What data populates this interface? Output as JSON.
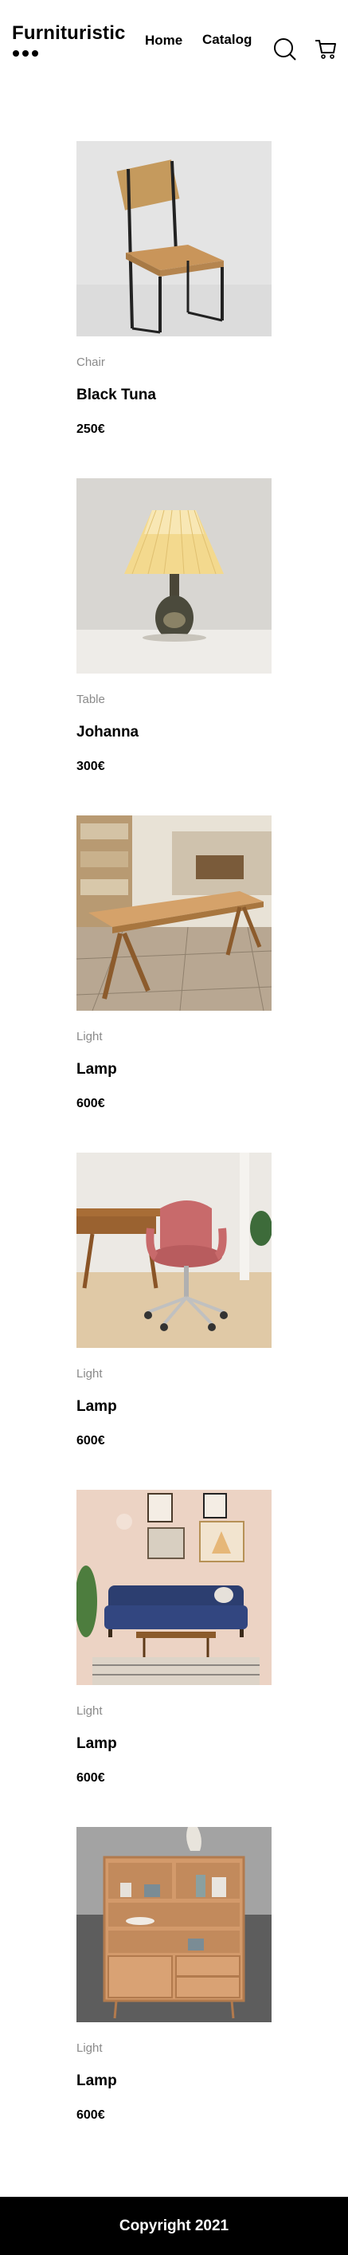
{
  "header": {
    "brand": "Furnituristic",
    "menu_icon": "dots-menu-icon",
    "nav": [
      {
        "label": "Home"
      },
      {
        "label": "Catalog"
      }
    ],
    "search_icon": "search-icon",
    "cart_icon": "cart-icon"
  },
  "products": [
    {
      "category": "Chair",
      "title": "Black Tuna",
      "price": "250€",
      "image": "wooden chair"
    },
    {
      "category": "Table",
      "title": "Johanna",
      "price": "300€",
      "image": "pleated table lamp"
    },
    {
      "category": "Light",
      "title": "Lamp",
      "price": "600€",
      "image": "wooden dining table"
    },
    {
      "category": "Light",
      "title": "Lamp",
      "price": "600€",
      "image": "pink office chair"
    },
    {
      "category": "Light",
      "title": "Lamp",
      "price": "600€",
      "image": "blue sofa living room"
    },
    {
      "category": "Light",
      "title": "Lamp",
      "price": "600€",
      "image": "wooden shelf cabinet"
    }
  ],
  "footer": {
    "text": "Copyright 2021"
  }
}
